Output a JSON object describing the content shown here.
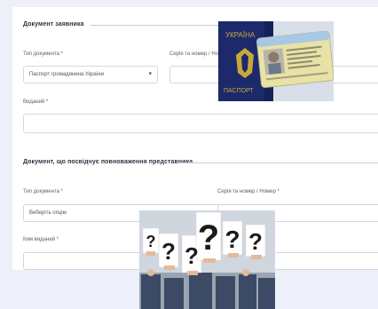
{
  "section_applicant": {
    "title": "Документ заявника",
    "doc_type_label": "Тип документа *",
    "doc_type_value": "Паспорт громадянина України",
    "series_label": "Серія та номер / Номер *",
    "issued_label": "Виданий *"
  },
  "section_representative": {
    "title": "Документ, що посвідчує повноваження представника",
    "doc_type_label": "Тип документа *",
    "doc_type_placeholder": "Виберіть опцію",
    "series_label": "Серія та номер / Номер *",
    "issued_by_label": "Ким виданий *"
  },
  "passport_image": {
    "cover_country": "УКРАЇНА",
    "cover_word": "ПАСПОРТ"
  },
  "questions_image": {
    "glyph": "?"
  },
  "colors": {
    "page_bg": "#eef0f9",
    "passport_blue": "#1c2a6b",
    "id_card_yellow": "#e8e2a6"
  }
}
